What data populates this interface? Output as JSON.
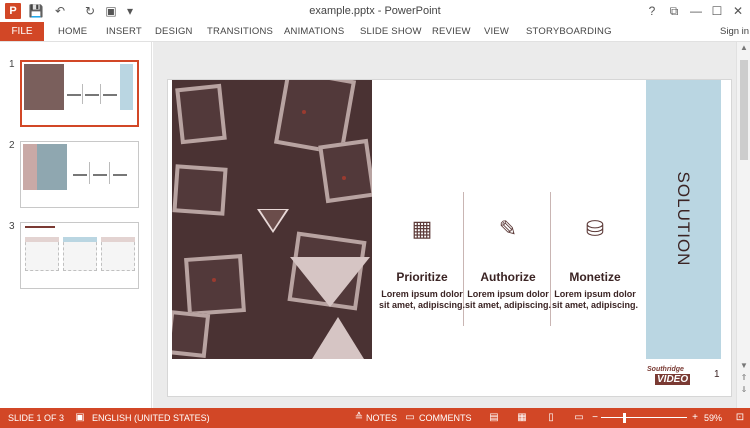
{
  "window": {
    "title": "example.pptx - PowerPoint",
    "app_logo": "P",
    "controls": {
      "help": "?",
      "restore_ribbon": "⧉",
      "minimize": "—",
      "maximize": "☐",
      "close": "✕"
    }
  },
  "quick_access": {
    "save_icon": "💾",
    "undo_icon": "↶",
    "redo_icon": "↻",
    "present_icon": "▣",
    "customize_icon": "▾"
  },
  "ribbon": {
    "file": "FILE",
    "tabs": [
      "HOME",
      "INSERT",
      "DESIGN",
      "TRANSITIONS",
      "ANIMATIONS",
      "SLIDE SHOW",
      "REVIEW",
      "VIEW",
      "STORYBOARDING"
    ],
    "sign_in": "Sign in"
  },
  "thumbnails": [
    {
      "number": "1",
      "selected": true
    },
    {
      "number": "2",
      "selected": false
    },
    {
      "number": "3",
      "selected": false
    }
  ],
  "slide": {
    "features": [
      {
        "icon": "blocks-icon",
        "glyph": "▦",
        "title": "Prioritize",
        "desc": "Lorem ipsum dolor sit amet, adipiscing."
      },
      {
        "icon": "pencil-icon",
        "glyph": "✎",
        "title": "Authorize",
        "desc": "Lorem ipsum dolor sit amet, adipiscing."
      },
      {
        "icon": "coins-icon",
        "glyph": "⛁",
        "title": "Monetize",
        "desc": "Lorem ipsum dolor sit amet, adipiscing."
      }
    ],
    "solution": "SOLUTION",
    "brand_top": "Southridge",
    "brand_bottom": "VIDEO",
    "number": "1"
  },
  "status": {
    "slide_info": "SLIDE 1 OF 3",
    "language": "ENGLISH (UNITED STATES)",
    "notes": "NOTES",
    "comments": "COMMENTS",
    "zoom": "59%",
    "zoom_level": 0.59
  },
  "colors": {
    "accent": "#d24726",
    "solution_band": "#bad6e2",
    "photo_tint": "#6b4d4b",
    "text_dark": "#3b2424"
  }
}
